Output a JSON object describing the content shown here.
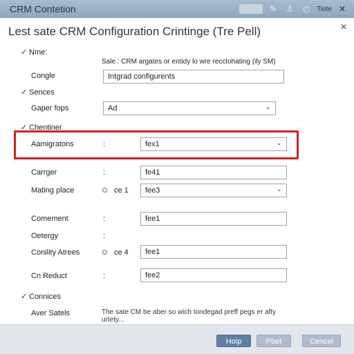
{
  "window": {
    "title": "CRM Contetion"
  },
  "dialog": {
    "heading": "Lest sate CRM Configuration Crintinge (Tre Pell)"
  },
  "help_label": "Tiote",
  "rows": {
    "name_label": "Nme:",
    "intro_text": "Sale ∶ CRM argates or entidy lo wre recctohating (ily SM)",
    "congle_label": "Congle",
    "congle_value": "Intgrad configurents",
    "sences_label": "Sences",
    "gaper_label": "Gaper fops",
    "gaper_value": "Ad",
    "chentiner_label": "Chentiner",
    "aamigrations_label": "Aamigratons",
    "aamigrations_value": "fex1",
    "carrger_label": "Carrger",
    "carrger_value": "fe41",
    "mating_label": "Mating place",
    "mating_radio": "ce 1",
    "mating_value": "fee3",
    "comement_label": "Comement",
    "comement_value": "fee1",
    "oetergy_label": "Oetergy",
    "conility_label": "Conility Atrees",
    "conility_radio": "ce 4",
    "conility_value": "fee1",
    "cnreduct_label": "Cn Reduct",
    "cnreduct_value": "fee2",
    "connices_label": "Connices",
    "aversatels_label": "Aver Satels",
    "note_text": "The sate CM be aber so wich tondegad preff pegs er afty urtety..."
  },
  "colon": ":",
  "check_mark": "✓",
  "buttons": {
    "help": "Hoip",
    "start": "Pbet",
    "cancel": "Cencel"
  },
  "icons": [
    "window-icon",
    "edit-icon",
    "user-icon",
    "help-icon",
    "close-icon"
  ],
  "colors": {
    "highlight": "#d21f1f",
    "titlebar": "#9fb3c8",
    "primary_button": "#5e7fa6"
  }
}
